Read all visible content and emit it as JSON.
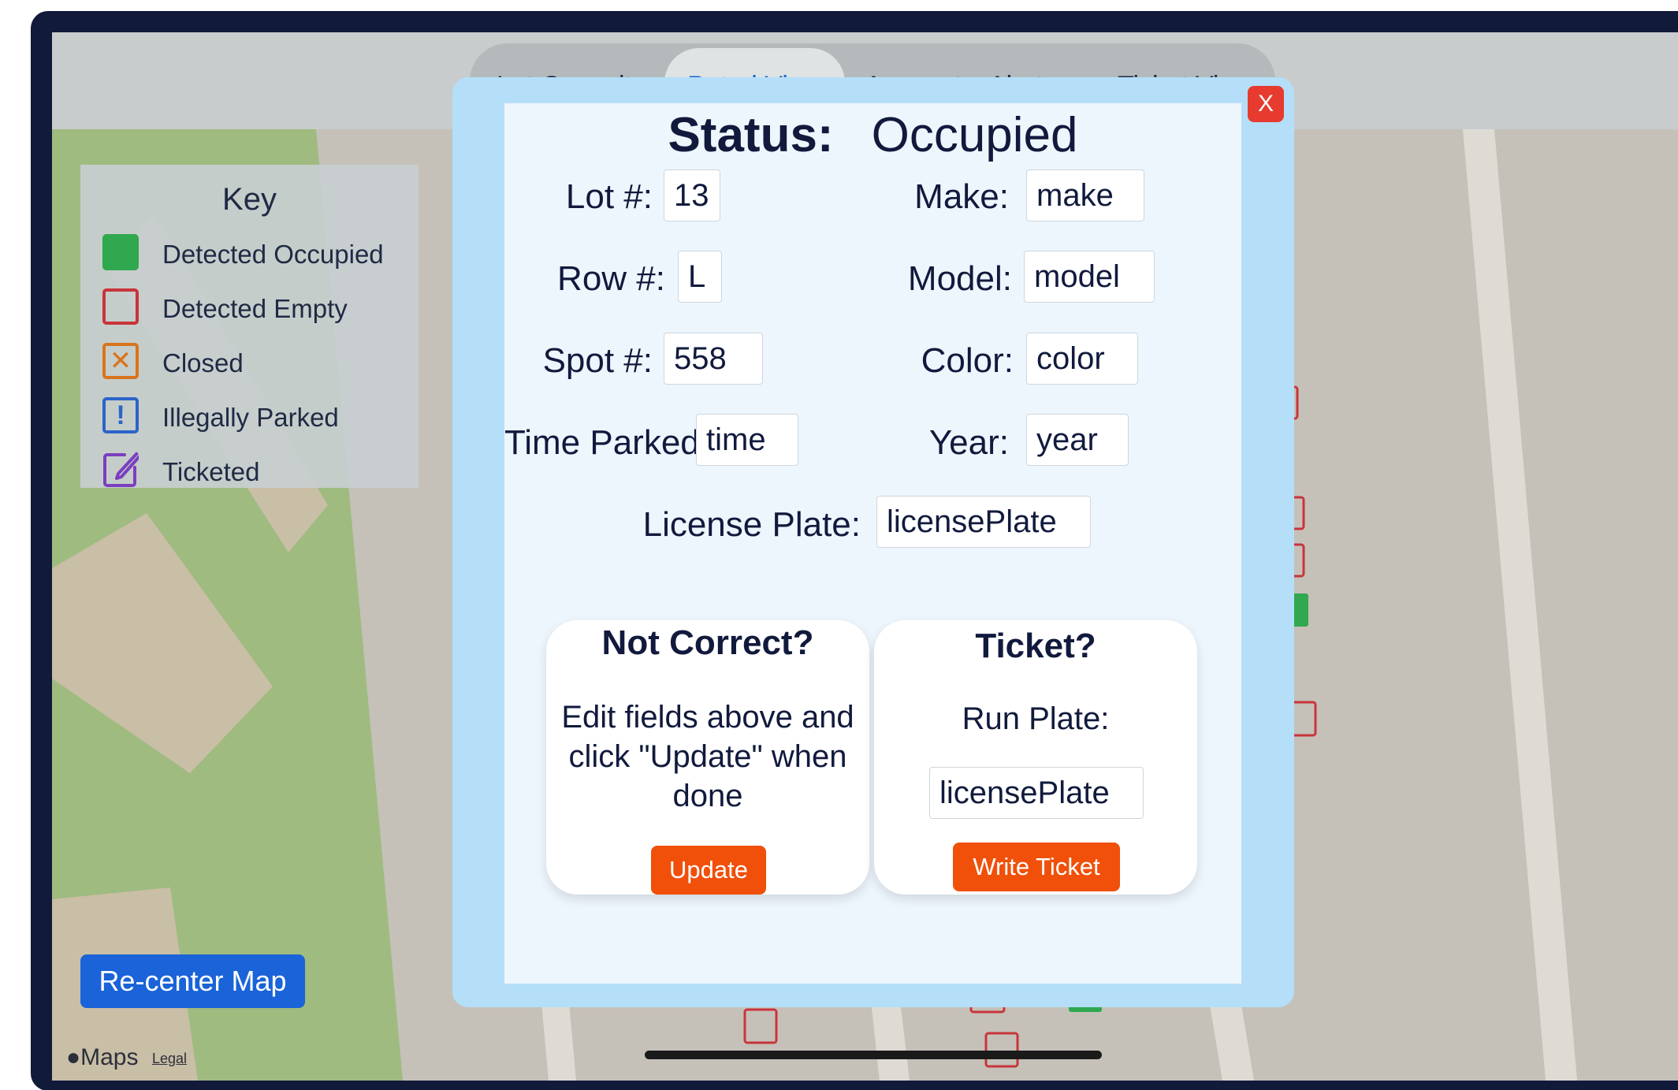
{
  "nav": {
    "tabs": [
      {
        "label": "Lot Capacity"
      },
      {
        "label": "Patrol View"
      },
      {
        "label": "Account"
      },
      {
        "label": "Alerts"
      },
      {
        "label": "Ticket View"
      }
    ],
    "active_tab": "Patrol View"
  },
  "key": {
    "title": "Key",
    "items": [
      {
        "label": "Detected Occupied",
        "icon": "filled-green-square-icon"
      },
      {
        "label": "Detected Empty",
        "icon": "empty-red-square-icon"
      },
      {
        "label": "Closed",
        "icon": "x-box-icon",
        "glyph": "✕"
      },
      {
        "label": "Illegally Parked",
        "icon": "exclamation-box-icon",
        "glyph": "!"
      },
      {
        "label": "Ticketed",
        "icon": "edit-square-icon"
      }
    ]
  },
  "map": {
    "recenter_label": "Re-center Map",
    "attribution": "Maps",
    "legal": "Legal"
  },
  "modal": {
    "close_label": "X",
    "status_label": "Status:",
    "status_value": "Occupied",
    "fields": {
      "lot": {
        "label": "Lot #:",
        "value": "13"
      },
      "row": {
        "label": "Row #:",
        "value": "L"
      },
      "spot": {
        "label": "Spot #:",
        "value": "558"
      },
      "time": {
        "label": "Time Parked:",
        "value": "time"
      },
      "make": {
        "label": "Make:",
        "value": "make"
      },
      "model": {
        "label": "Model:",
        "value": "model"
      },
      "color": {
        "label": "Color:",
        "value": "color"
      },
      "year": {
        "label": "Year:",
        "value": "year"
      },
      "plate": {
        "label": "License Plate:",
        "value": "licensePlate"
      }
    },
    "not_correct": {
      "title": "Not Correct?",
      "line1": "Edit fields above and",
      "line2": "click \"Update\" when",
      "line3": "done",
      "button": "Update"
    },
    "ticket": {
      "title": "Ticket?",
      "run_plate_label": "Run Plate:",
      "plate_value": "licensePlate",
      "button": "Write Ticket"
    }
  },
  "colors": {
    "accent_blue": "#1a63d8",
    "action_orange": "#f0500a",
    "close_red": "#e63b2e",
    "modal_bg": "#b5def9",
    "occupied_green": "#2fa84f",
    "empty_red": "#c8353a",
    "closed_orange": "#d9741c",
    "illegal_blue": "#2c64c8",
    "ticketed_purple": "#7b3fbf"
  }
}
